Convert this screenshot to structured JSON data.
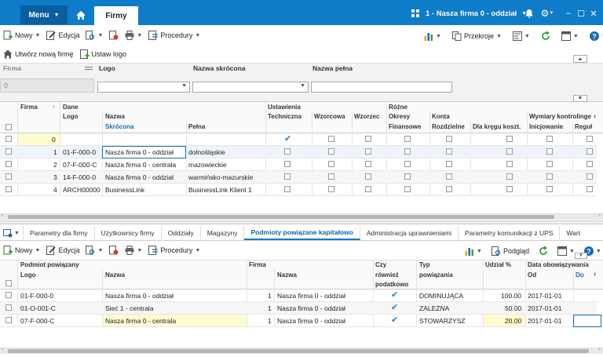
{
  "titlebar": {
    "menu_label": "Menu",
    "tab_label": "Firmy",
    "company_selector": "1 - Nasza firma 0 - oddział"
  },
  "toolbar1": {
    "new_label": "Nowy",
    "edit_label": "Edycja",
    "procedures_label": "Procedury",
    "views_label": "Przekroje"
  },
  "toolbar2": {
    "create_company_label": "Utwórz nową firmę",
    "set_logo_label": "Ustaw logo"
  },
  "filter": {
    "firma_label": "Firma",
    "firma_value": "0",
    "logo_label": "Logo",
    "short_name_label": "Nazwa skrócona",
    "full_name_label": "Nazwa pełna"
  },
  "grid": {
    "headers": {
      "firma": "Firma",
      "dane": "Dane",
      "logo": "Logo",
      "nazwa": "Nazwa",
      "skrocona": "Skrócona",
      "pelna": "Pełna",
      "ustawienia": "Ustawienia",
      "techniczna": "Techniczna",
      "wzorcowa": "Wzorcowa",
      "wzorzec": "Wzorzec",
      "rozne": "Różne",
      "okresy": "Okresy",
      "finansowe": "Finansowe",
      "konta": "Konta",
      "rozdzielne": "Rozdzielne",
      "dla_kregu": "Dla kręgu koszt.",
      "wymiary": "Wymiary kontrolinge",
      "inicjowanie": "Inicjowanie",
      "regul": "Reguł"
    },
    "rows": [
      {
        "firma": "0",
        "logo": "",
        "skrocona": "",
        "pelna": ""
      },
      {
        "firma": "1",
        "logo": "01-F-000-0",
        "skrocona": "Nasza firma 0 - oddział",
        "pelna": "dolnośląskie"
      },
      {
        "firma": "2",
        "logo": "07-F-000-C",
        "skrocona": "Nasza firma 0 - centrala",
        "pelna": "mazowieckie"
      },
      {
        "firma": "3",
        "logo": "14-F-000-0",
        "skrocona": "Nasza firma 0 - oddział",
        "pelna": "warmińsko-mazurskie"
      },
      {
        "firma": "4",
        "logo": "ARCH00000",
        "skrocona": "BusinessLink",
        "pelna": "BusinessLink Klient 1"
      }
    ]
  },
  "tabs": [
    "Parametry dla firmy",
    "Użytkownicy firmy",
    "Oddziały",
    "Magazyny",
    "Podmioty powiązane kapitałowo",
    "Administracja uprawnieniami",
    "Parametry komunikacji z UPS",
    "Wart"
  ],
  "toolbar3": {
    "new_label": "Nowy",
    "edit_label": "Edycja",
    "procedures_label": "Procedury",
    "preview_label": "Podgląd"
  },
  "grid2": {
    "headers": {
      "podmiot": "Podmiot powiązany",
      "logo": "Logo",
      "nazwa": "Nazwa",
      "firma": "Firma",
      "firma_nazwa": "Nazwa",
      "czy1": "Czy",
      "czy2": "również",
      "czy3": "podatkowo",
      "typ": "Typ",
      "typ2": "powiązania",
      "udzial": "Udział %",
      "data": "Data obowiązywania",
      "od": "Od",
      "do": "Do"
    },
    "rows": [
      {
        "logo": "01-F-000-0",
        "nazwa": "Nasza firma 0 - oddział",
        "firma": "1",
        "firma_nazwa": "Nasza firma 0 - oddział",
        "typ": "DOMINUJĄCA",
        "udzial": "100.00",
        "od": "2017-01-01"
      },
      {
        "logo": "01-O-001-C",
        "nazwa": "Sieć 1 - centrala",
        "firma": "1",
        "firma_nazwa": "Nasza firma 0 - oddział",
        "typ": "ZALEŻNA",
        "udzial": "50.00",
        "od": "2017-01-01"
      },
      {
        "logo": "07-F-000-C",
        "nazwa": "Nasza firma 0 - centrala",
        "firma": "1",
        "firma_nazwa": "Nasza firma 0 - oddział",
        "typ": "STOWARZYSZ",
        "udzial": "20.00",
        "od": "2017-01-01"
      }
    ]
  },
  "colors": {
    "titlebar": "#0e7cc8",
    "menu": "#0a5ea0",
    "highlight": "#fffbd0",
    "check": "#1a7ed0"
  }
}
